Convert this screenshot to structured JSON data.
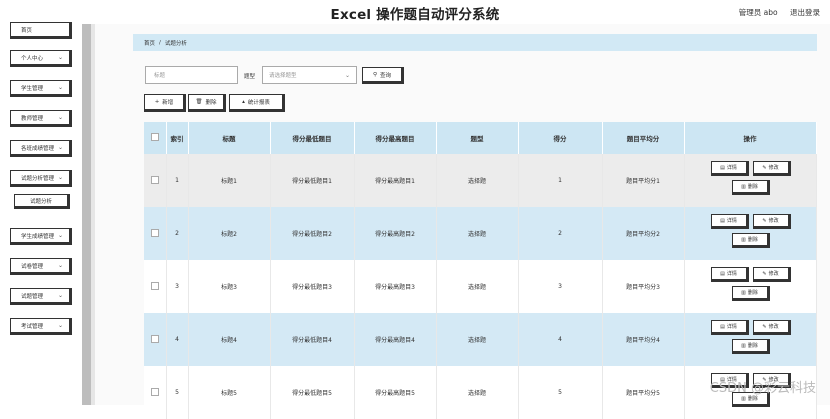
{
  "header": {
    "title": "Excel 操作题自动评分系统",
    "user": "管理员 abo",
    "logout": "退出登录"
  },
  "sidebar": {
    "items": [
      {
        "label": "首页"
      },
      {
        "label": "个人中心"
      },
      {
        "label": "学生管理"
      },
      {
        "label": "教师管理"
      },
      {
        "label": "各班成绩管理"
      },
      {
        "label": "试题分析管理"
      },
      {
        "label": "试题分析"
      },
      {
        "label": "学生成绩管理"
      },
      {
        "label": "试卷管理"
      },
      {
        "label": "试题管理"
      },
      {
        "label": "考试管理"
      }
    ]
  },
  "breadcrumb": {
    "home": "首页",
    "sep": "/",
    "current": "试题分析"
  },
  "search": {
    "title_placeholder": "标题",
    "type_label": "题型",
    "type_placeholder": "请选择题型",
    "query": "查询"
  },
  "toolbar": {
    "add": "新增",
    "delete": "删除",
    "stats": "统计报表"
  },
  "table": {
    "headers": [
      "索引",
      "标题",
      "得分最低题目",
      "得分最高题目",
      "题型",
      "得分",
      "题目平均分",
      "操作"
    ],
    "rows": [
      {
        "index": "1",
        "title": "标题1",
        "low": "得分最低题目1",
        "high": "得分最高题目1",
        "type": "选择题",
        "score": "1",
        "avg": "题目平均分1"
      },
      {
        "index": "2",
        "title": "标题2",
        "low": "得分最低题目2",
        "high": "得分最高题目2",
        "type": "选择题",
        "score": "2",
        "avg": "题目平均分2"
      },
      {
        "index": "3",
        "title": "标题3",
        "low": "得分最低题目3",
        "high": "得分最高题目3",
        "type": "选择题",
        "score": "3",
        "avg": "题目平均分3"
      },
      {
        "index": "4",
        "title": "标题4",
        "low": "得分最低题目4",
        "high": "得分最高题目4",
        "type": "选择题",
        "score": "4",
        "avg": "题目平均分4"
      },
      {
        "index": "5",
        "title": "标题5",
        "low": "得分最低题目5",
        "high": "得分最高题目5",
        "type": "选择题",
        "score": "5",
        "avg": "题目平均分5"
      }
    ],
    "actions": {
      "detail": "详情",
      "edit": "修改",
      "delete": "删除"
    }
  },
  "watermark": "CSDN @彩云科技"
}
